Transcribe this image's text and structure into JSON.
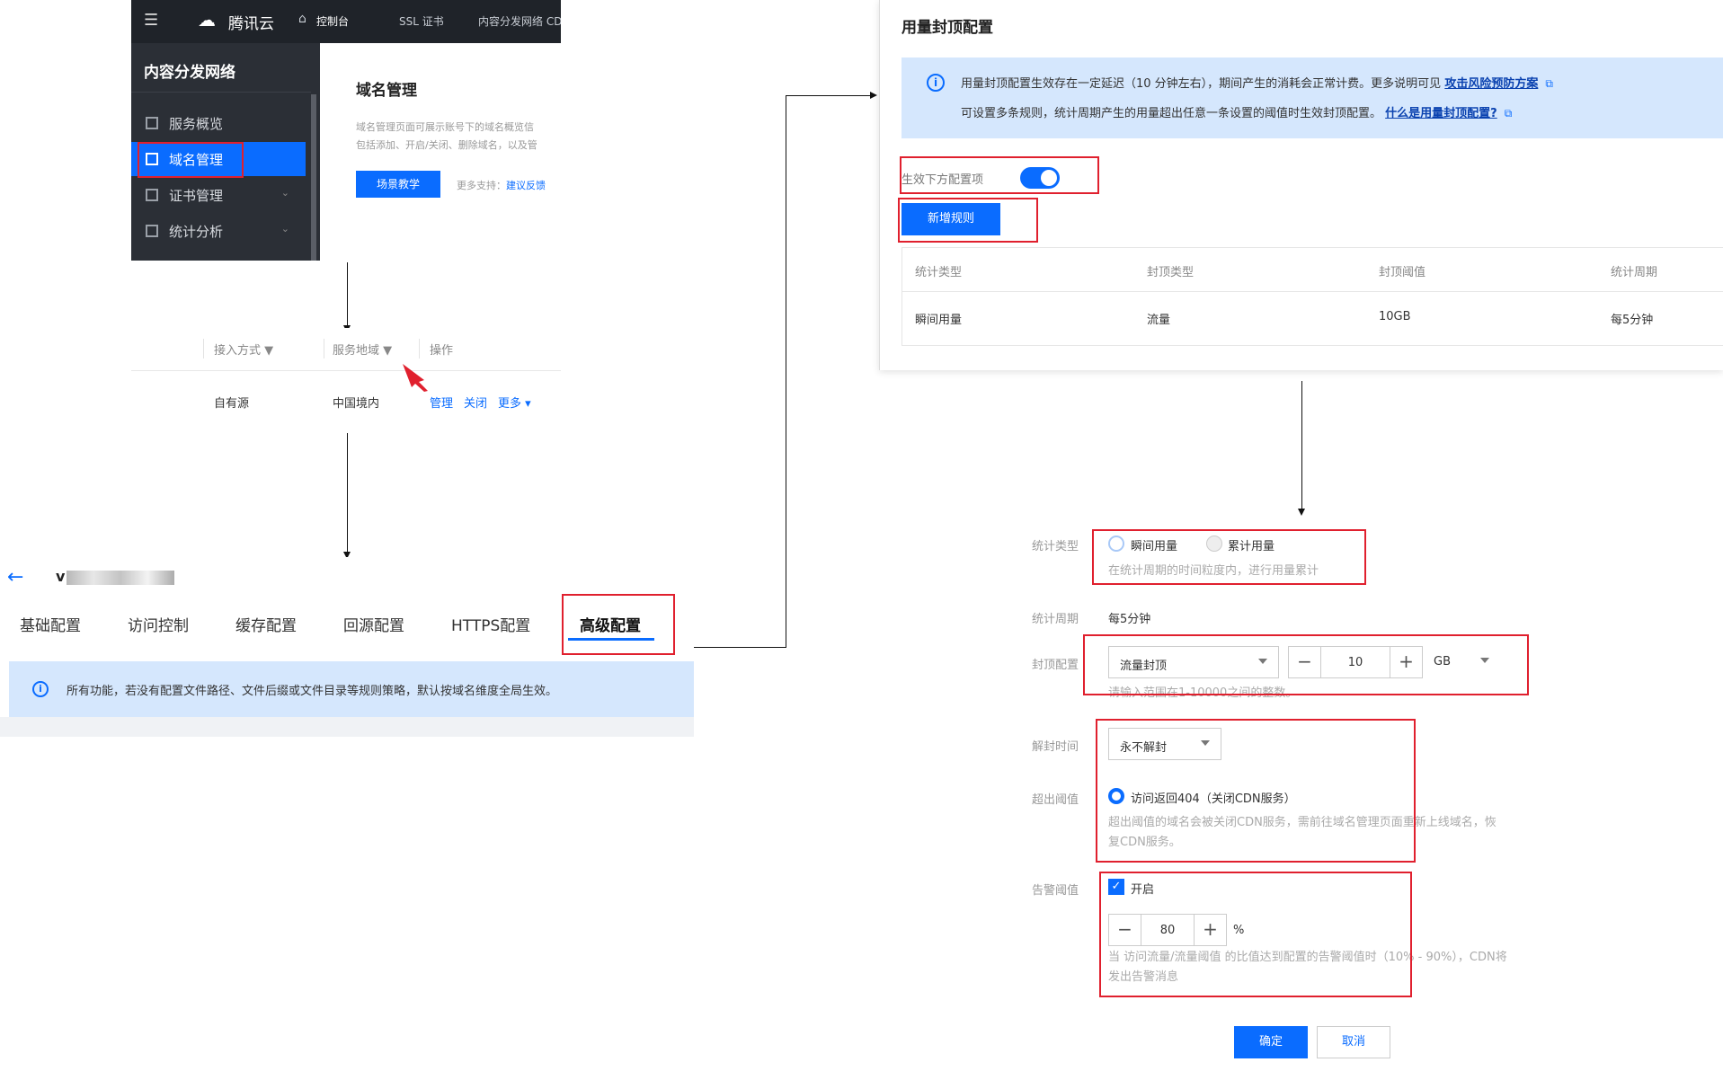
{
  "console": {
    "brand": "腾讯云",
    "nav_console": "控制台",
    "nav_ssl": "SSL 证书",
    "nav_cdn": "内容分发网络 CD",
    "sidebar_title": "内容分发网络",
    "sidebar_items": [
      {
        "label": "服务概览"
      },
      {
        "label": "域名管理"
      },
      {
        "label": "证书管理"
      },
      {
        "label": "统计分析"
      }
    ],
    "content_title": "域名管理",
    "content_desc_1": "域名管理页面可展示账号下的域名概览信",
    "content_desc_2": "包括添加、开启/关闭、删除域名，以及管",
    "scene_button": "场景教学",
    "more_support": "更多支持：",
    "feedback_link": "建议反馈"
  },
  "domain_table": {
    "headers": [
      "接入方式",
      "服务地域",
      "操作"
    ],
    "row": {
      "access": "自有源",
      "region": "中国境内",
      "manage": "管理",
      "close": "关闭",
      "more": "更多"
    }
  },
  "domain_config": {
    "domain_initial": "v",
    "tabs": [
      "基础配置",
      "访问控制",
      "缓存配置",
      "回源配置",
      "HTTPS配置",
      "高级配置"
    ],
    "notice": "所有功能，若没有配置文件路径、文件后缀或文件目录等规则策略，默认按域名维度全局生效。"
  },
  "usage_cap": {
    "title": "用量封顶配置",
    "notice_line1": "用量封顶配置生效存在一定延迟（10 分钟左右），期间产生的消耗会正常计费。更多说明可见",
    "notice_link1": "攻击风险预防方案",
    "notice_line2": "可设置多条规则，统计周期产生的用量超出任意一条设置的阈值时生效封顶配置。",
    "notice_link2": "什么是用量封顶配置?",
    "switch_label": "生效下方配置项",
    "add_rule": "新增规则",
    "table_headers": [
      "统计类型",
      "封顶类型",
      "封顶阈值",
      "统计周期"
    ],
    "table_row": [
      "瞬间用量",
      "流量",
      "10GB",
      "每5分钟"
    ]
  },
  "rule_form": {
    "stat_type_label": "统计类型",
    "stat_type_options": [
      "瞬间用量",
      "累计用量"
    ],
    "stat_type_hint": "在统计周期的时间粒度内，进行用量累计",
    "stat_period_label": "统计周期",
    "stat_period_value": "每5分钟",
    "cap_label": "封顶配置",
    "cap_type": "流量封顶",
    "cap_value": "10",
    "cap_unit": "GB",
    "cap_hint": "请输入范围在1-10000之间的整数。",
    "unblock_label": "解封时间",
    "unblock_value": "永不解封",
    "exceed_label": "超出阈值",
    "exceed_option": "访问返回404（关闭CDN服务）",
    "exceed_hint_1": "超出阈值的域名会被关闭CDN服务，需前往域名管理页面重新上线域名，恢",
    "exceed_hint_2": "复CDN服务。",
    "alarm_label": "告警阈值",
    "alarm_enable": "开启",
    "alarm_value": "80",
    "alarm_unit": "%",
    "alarm_hint_1": "当 访问流量/流量阈值 的比值达到配置的告警阈值时（10% - 90%），CDN将",
    "alarm_hint_2": "发出告警消息",
    "confirm": "确定",
    "cancel": "取消"
  }
}
